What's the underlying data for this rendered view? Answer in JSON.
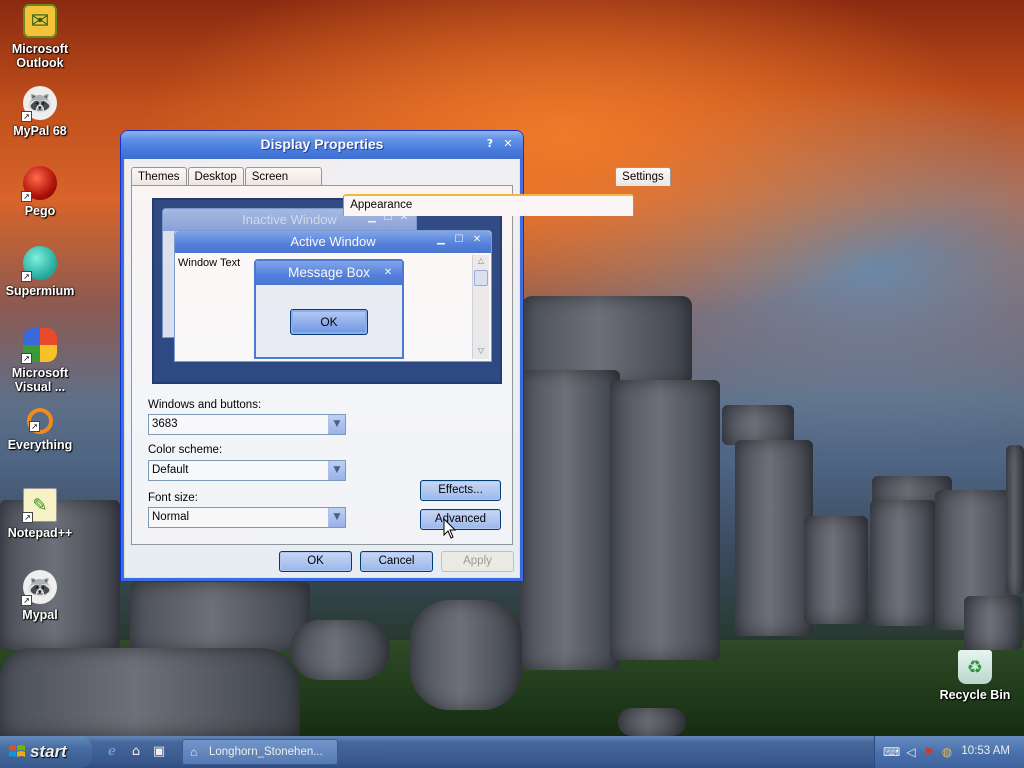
{
  "desktop": {
    "icons": [
      {
        "label": "Microsoft\nOutlook",
        "line1": "Microsoft",
        "line2": "Outlook",
        "icon": "outlook-icon"
      },
      {
        "label": "MyPal 68",
        "line1": "MyPal 68",
        "line2": "",
        "icon": "mypal-icon"
      },
      {
        "label": "Pego",
        "line1": "Pego",
        "line2": "",
        "icon": "pego-icon"
      },
      {
        "label": "Supermium",
        "line1": "Supermium",
        "line2": "",
        "icon": "supermium-icon"
      },
      {
        "label": "Microsoft Visual ...",
        "line1": "Microsoft",
        "line2": "Visual ...",
        "icon": "visual-studio-icon"
      },
      {
        "label": "Everything",
        "line1": "Everything",
        "line2": "",
        "icon": "everything-icon"
      },
      {
        "label": "Notepad++",
        "line1": "Notepad++",
        "line2": "",
        "icon": "notepadpp-icon"
      },
      {
        "label": "Mypal",
        "line1": "Mypal",
        "line2": "",
        "icon": "mypal-icon"
      }
    ],
    "recycle_bin": "Recycle Bin"
  },
  "dialog": {
    "title": "Display Properties",
    "help": "?",
    "close": "✕",
    "tabs": [
      "Themes",
      "Desktop",
      "Screen Saver",
      "Appearance",
      "Settings"
    ],
    "active_tab": "Appearance",
    "preview": {
      "inactive_title": "Inactive Window",
      "active_title": "Active Window",
      "window_text": "Window Text",
      "message_box_title": "Message Box",
      "message_box_ok": "OK",
      "min": "▁",
      "max": "☐",
      "close": "✕"
    },
    "windows_and_buttons": {
      "label": "Windows and buttons:",
      "value": "3683"
    },
    "color_scheme": {
      "label": "Color scheme:",
      "value": "Default"
    },
    "font_size": {
      "label": "Font size:",
      "value": "Normal"
    },
    "effects_button": "Effects...",
    "advanced_button": "Advanced",
    "ok_button": "OK",
    "cancel_button": "Cancel",
    "apply_button": "Apply"
  },
  "taskbar": {
    "start_label": "start",
    "task_label": "Longhorn_Stonehen...",
    "clock": "10:53 AM"
  }
}
